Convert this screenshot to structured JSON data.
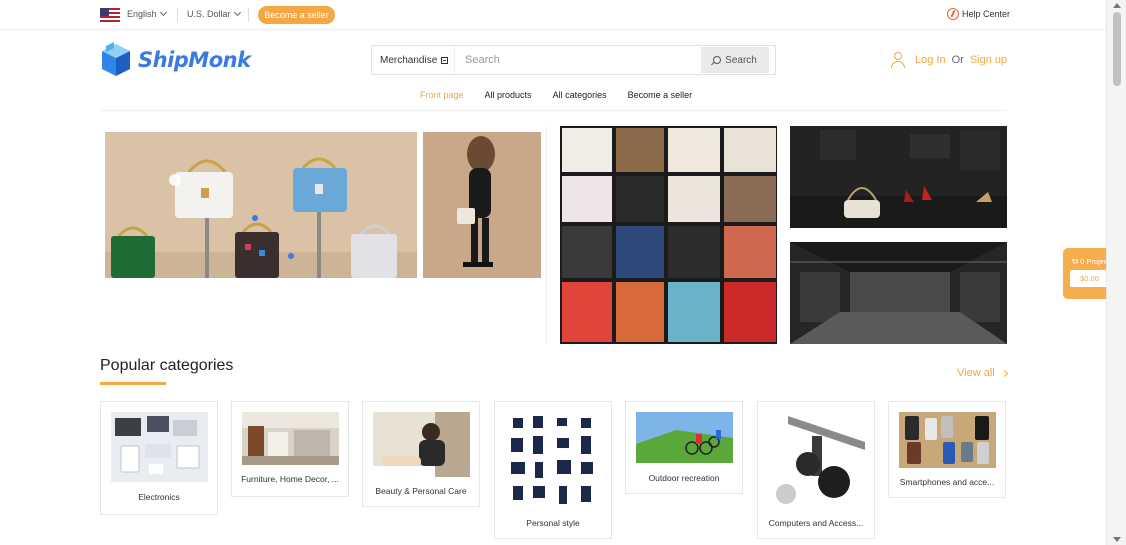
{
  "topbar": {
    "language": "English",
    "currency": "U.S. Dollar",
    "become_seller": "Become a seller",
    "help_center": "Help Center"
  },
  "header": {
    "logo_text": "ShipMonk",
    "search_category": "Merchandise",
    "search_placeholder": "Search",
    "search_button": "Search",
    "login": "Log In",
    "or": "Or",
    "signup": "Sign up"
  },
  "nav": {
    "items": [
      "Front page",
      "All products",
      "All categories",
      "Become a seller"
    ],
    "active_index": 0
  },
  "categories": {
    "title": "Popular categories",
    "view_all": "View all",
    "items": [
      {
        "label": "Electronics"
      },
      {
        "label": "Furniture, Home Decor, ..."
      },
      {
        "label": "Beauty & Personal Care"
      },
      {
        "label": "Personal style"
      },
      {
        "label": "Outdoor recreation"
      },
      {
        "label": "Computers and Access..."
      },
      {
        "label": "Smartphones and acce..."
      }
    ]
  },
  "cart": {
    "title": "0 Project",
    "amount": "$0.00"
  },
  "colors": {
    "accent": "#f4a742",
    "logo_blue": "#3a7be0"
  }
}
